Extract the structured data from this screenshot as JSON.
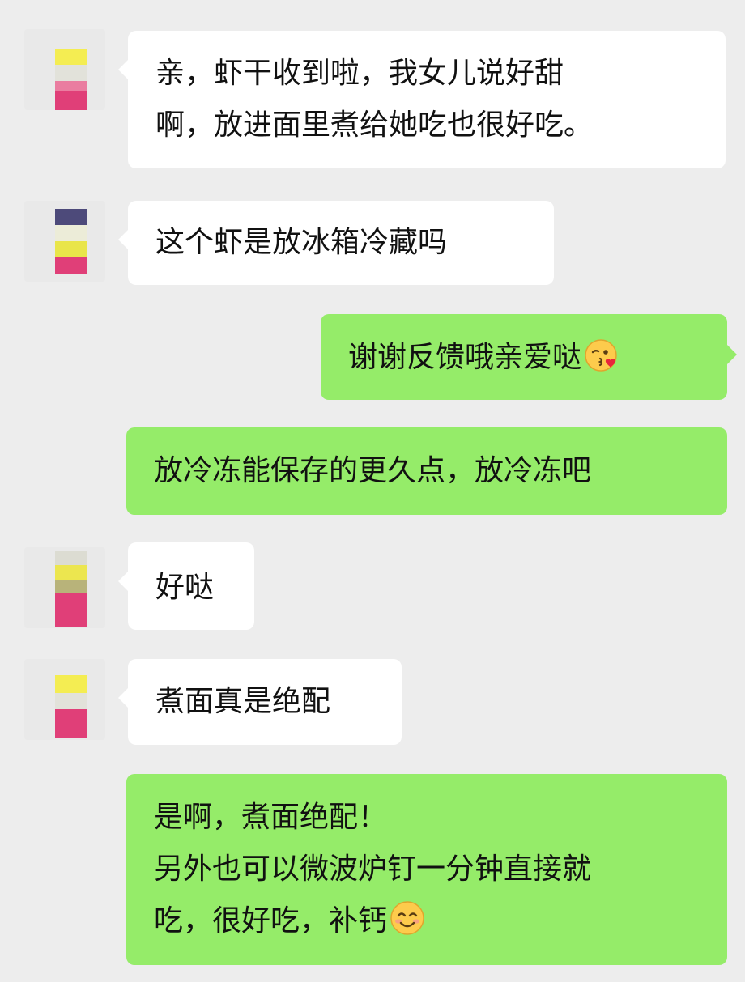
{
  "conversation": {
    "messages": [
      {
        "sender": "contact",
        "lines": [
          "亲，虾干收到啦，我女儿说好甜",
          "啊，放进面里煮给她吃也很好吃。"
        ]
      },
      {
        "sender": "contact",
        "lines": [
          "这个虾是放冰箱冷藏吗"
        ]
      },
      {
        "sender": "me",
        "lines": [
          "谢谢反馈哦亲爱哒"
        ],
        "emoji": "kissing-heart-emoji"
      },
      {
        "sender": "me",
        "lines": [
          "放冷冻能保存的更久点，放冷冻吧"
        ]
      },
      {
        "sender": "contact",
        "lines": [
          "好哒"
        ]
      },
      {
        "sender": "contact",
        "lines": [
          "煮面真是绝配"
        ]
      },
      {
        "sender": "me",
        "lines": [
          "是啊，煮面绝配！",
          "另外也可以微波炉钉一分钟直接就",
          "吃，很好吃，补钙"
        ],
        "emoji": "smiling-blush-emoji"
      }
    ]
  },
  "colors": {
    "background": "#ededed",
    "incoming_bubble": "#ffffff",
    "outgoing_bubble": "#95ec69",
    "text": "#111111",
    "avatar_pixel_yellow": "#f2ea3c",
    "avatar_pixel_pink": "#e03f78",
    "avatar_pixel_navy": "#4d4a7a"
  }
}
